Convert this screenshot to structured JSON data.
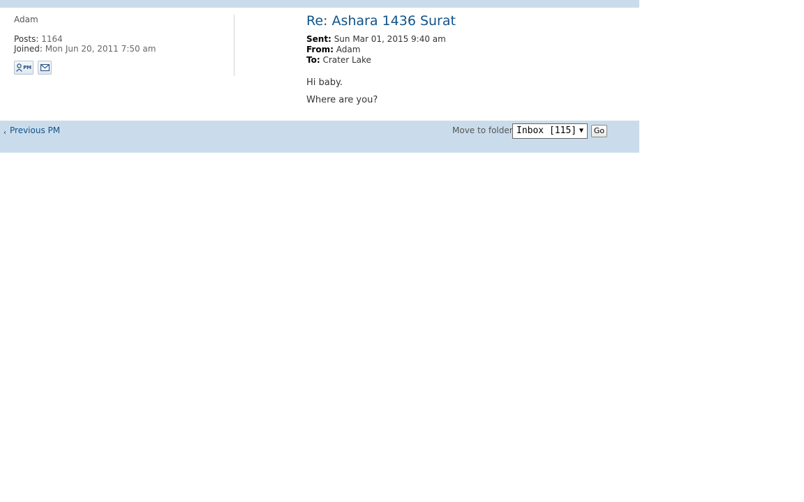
{
  "post": {
    "author": "Adam",
    "posts_label": "Posts:",
    "posts_value": "1164",
    "joined_label": "Joined:",
    "joined_value": "Mon Jun 20, 2011 7:50 am",
    "pm_icon_text": "PM"
  },
  "message": {
    "subject": "Re: Ashara 1436 Surat",
    "sent_label": "Sent:",
    "sent_value": "Sun Mar 01, 2015 9:40 am",
    "from_label": "From:",
    "from_value": "Adam",
    "to_label": "To:",
    "to_value": "Crater Lake",
    "body": [
      "Hi baby.",
      "Where are you?"
    ]
  },
  "footer": {
    "prev_arrow": "‹",
    "prev_label": "Previous PM",
    "move_label": "Move to folder:",
    "folder_selected": "Inbox [115]",
    "select_arrow": "▼",
    "go_label": "Go"
  },
  "colors": {
    "band": "#cadceb",
    "link": "#105289"
  }
}
